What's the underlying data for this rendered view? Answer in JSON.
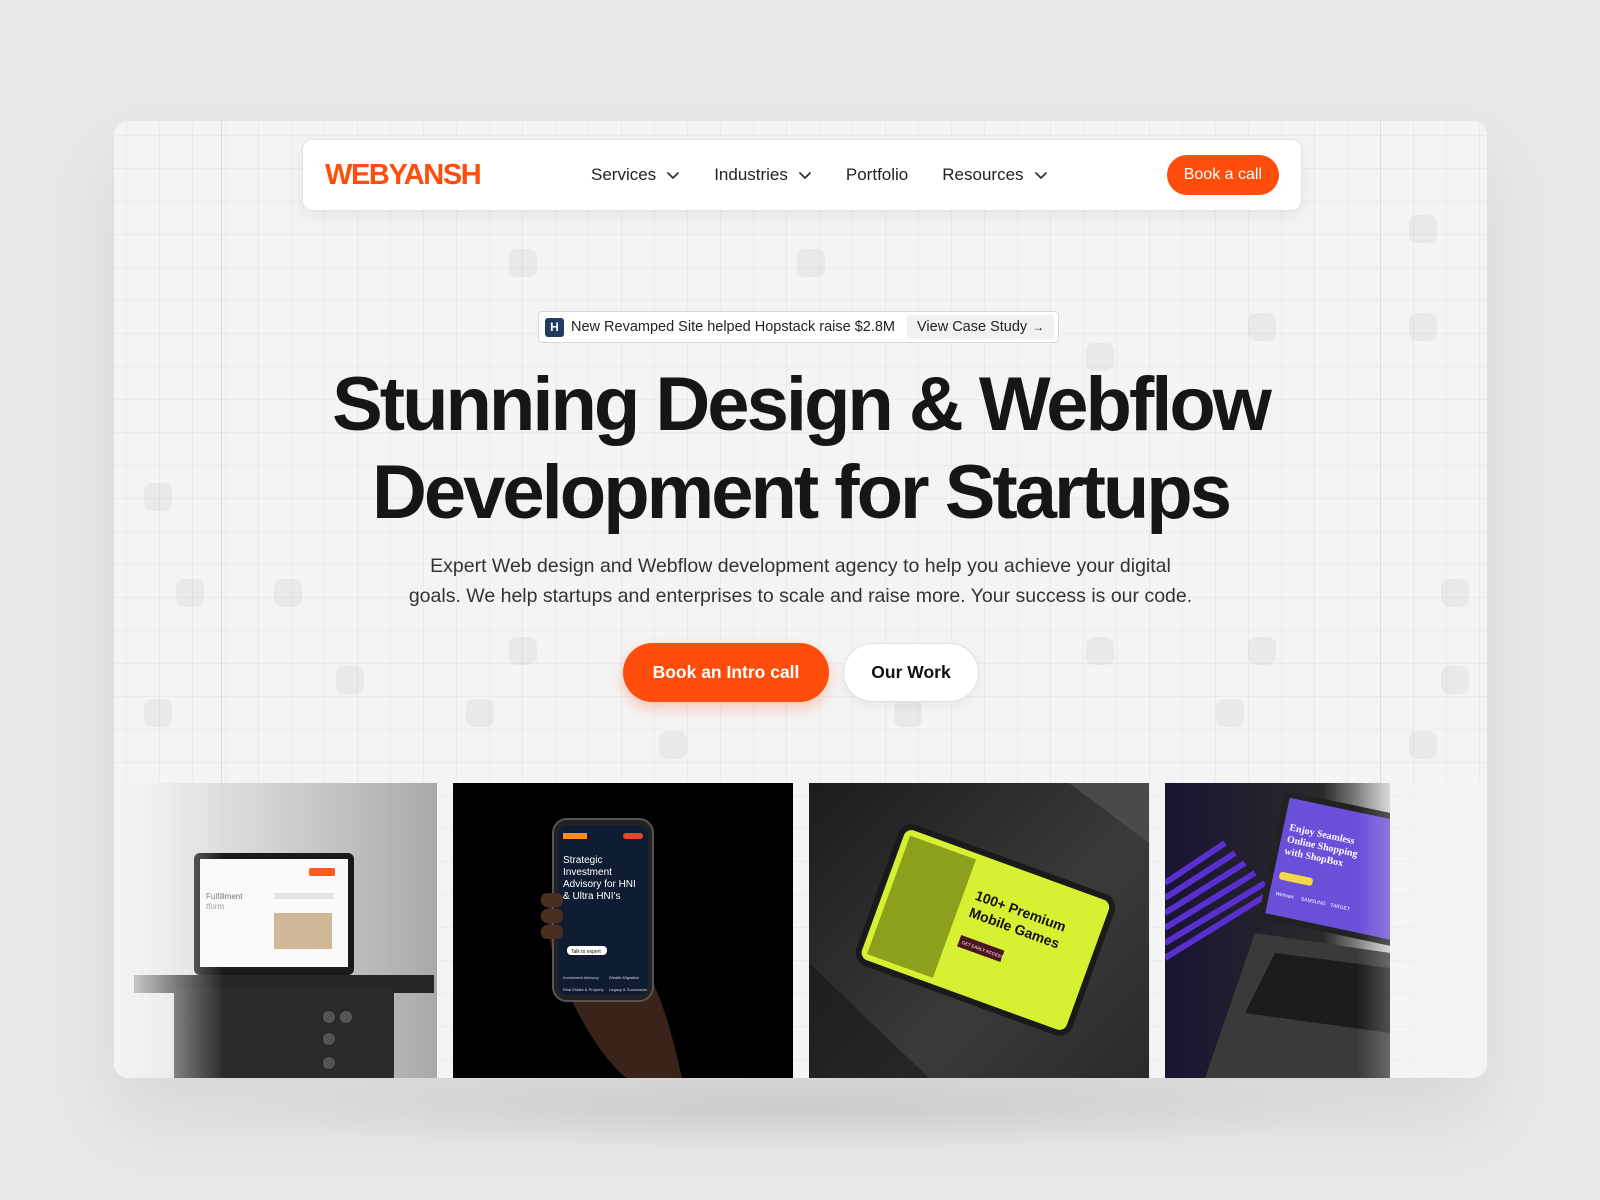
{
  "brand": {
    "logo_text": "WEBYANSH",
    "accent_color": "#ff4d0b"
  },
  "nav": {
    "items": [
      {
        "label": "Services",
        "has_dropdown": true
      },
      {
        "label": "Industries",
        "has_dropdown": true
      },
      {
        "label": "Portfolio",
        "has_dropdown": false
      },
      {
        "label": "Resources",
        "has_dropdown": true
      }
    ],
    "cta_label": "Book a call"
  },
  "announcement": {
    "icon_letter": "H",
    "text": "New Revamped Site helped Hopstack raise $2.8M",
    "link_label": "View Case Study",
    "link_icon": "arrow-right-icon"
  },
  "hero": {
    "headline_line1": "Stunning Design & Webflow",
    "headline_line2": "Development for Startups",
    "subtext_line1": "Expert Web design and Webflow development agency to help you achieve your digital",
    "subtext_line2": "goals. We help startups and enterprises to scale and raise more. Your success is our code.",
    "primary_cta": "Book an Intro call",
    "secondary_cta": "Our Work"
  },
  "showcase": {
    "cards": [
      {
        "id": "laptop-fulfillment",
        "texts": [
          "Fulfillment",
          "tform"
        ]
      },
      {
        "id": "phone-investment",
        "texts": [
          "Strategic Investment Advisory for HNI & Ultra HNI's",
          "Talk to expert",
          "Investment Advisory",
          "Wealth Migration",
          "Real Estate & Property",
          "Legacy & Succession"
        ]
      },
      {
        "id": "tablet-games",
        "texts": [
          "100+ Premium Mobile Games",
          "GET EARLY ACCESS"
        ]
      },
      {
        "id": "laptop-shopbox",
        "texts": [
          "Enjoy Seamless Online Shopping with ShopBox",
          "Walmart",
          "SAMSUNG",
          "TARGET"
        ]
      }
    ]
  }
}
